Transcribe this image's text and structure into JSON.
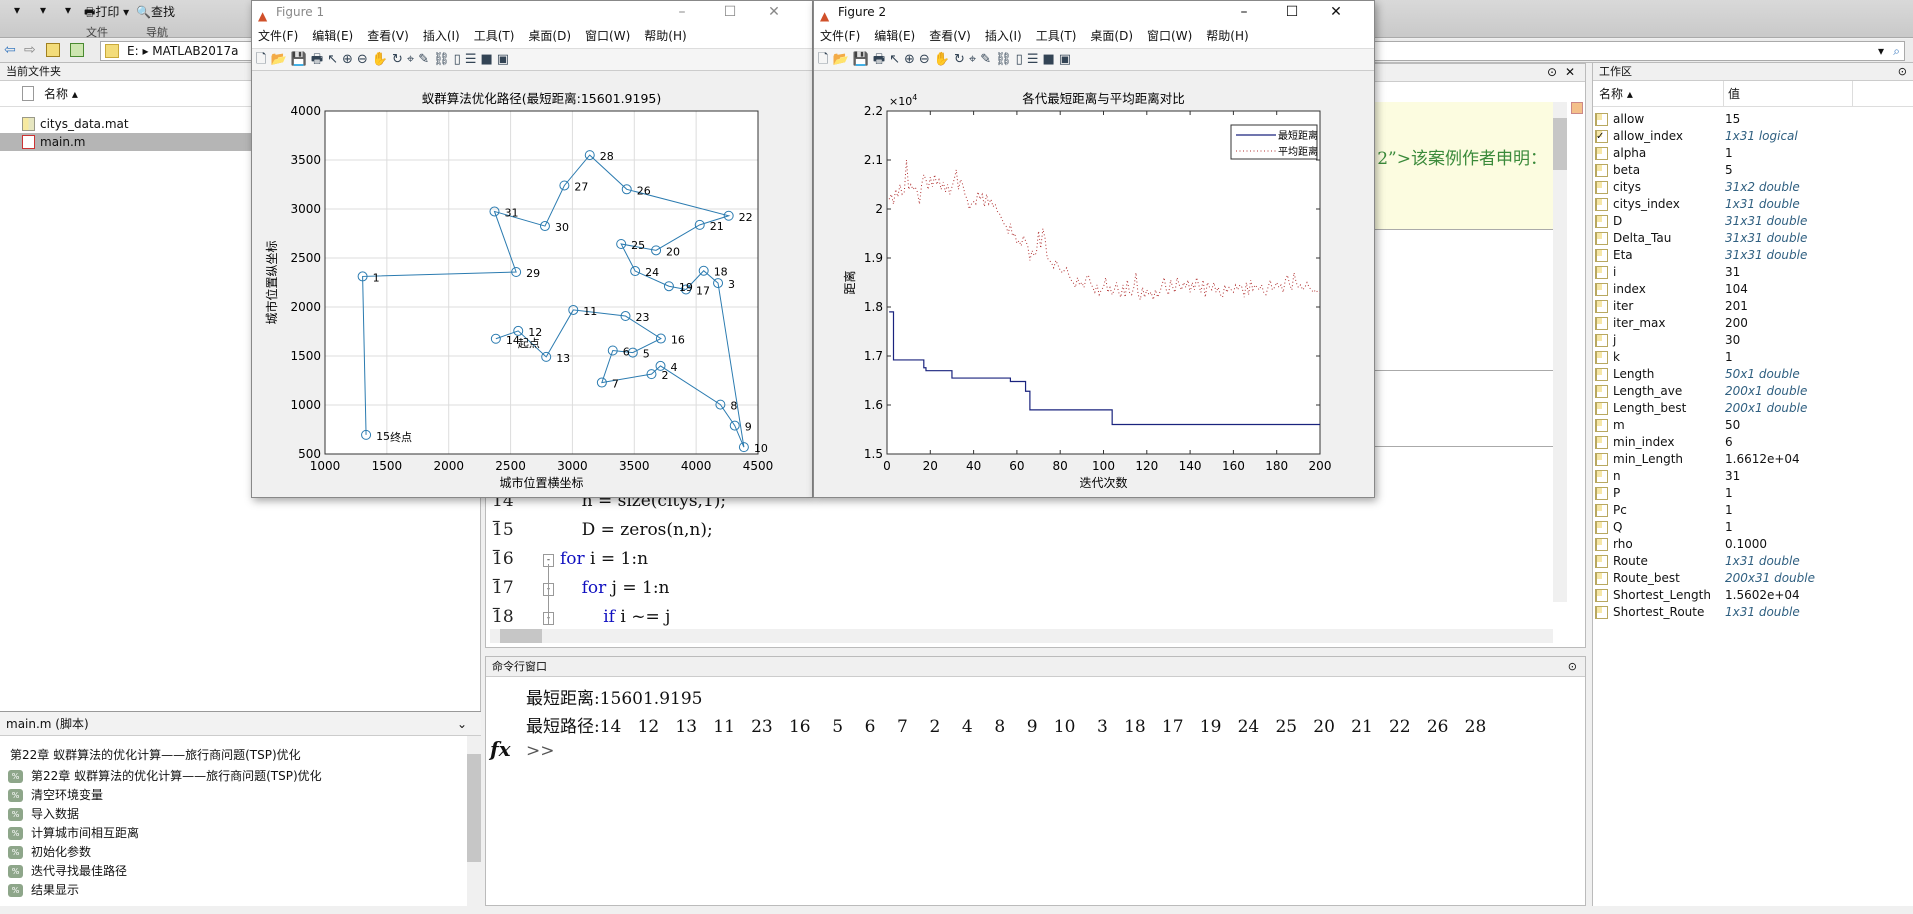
{
  "toolbar": {
    "print": "打印",
    "find": "查找",
    "group_file": "文件",
    "group_nav": "导航"
  },
  "address": {
    "path": "E:  ▸  MATLAB2017a"
  },
  "files": {
    "title": "当前文件夹",
    "col_name": "名称 ▴",
    "items": [
      {
        "name": "citys_data.mat",
        "selected": false
      },
      {
        "name": "main.m",
        "selected": true
      }
    ]
  },
  "details": {
    "title": "main.m  (脚本)",
    "heading": "第22章 蚁群算法的优化计算——旅行商问题(TSP)优化",
    "sections": [
      "第22章 蚁群算法的优化计算——旅行商问题(TSP)优化",
      "清空环境变量",
      "导入数据",
      "计算城市间相互距离",
      "初始化参数",
      "迭代寻找最佳路径",
      "结果显示"
    ]
  },
  "editor": {
    "cell_text": "2”>该案例作者申明：",
    "lines": [
      {
        "num": "14",
        "code": "    n = size(citys,1);"
      },
      {
        "num": "15",
        "code": "    D = zeros(n,n);"
      },
      {
        "num": "16",
        "kw": "for",
        "code": " i = 1:n"
      },
      {
        "num": "17",
        "kw": "    for",
        "code": " j = 1:n"
      },
      {
        "num": "18",
        "kw": "        if",
        "code": " i ~= j"
      }
    ]
  },
  "command": {
    "title": "命令行窗口",
    "line1": "最短距离:15601.9195",
    "line2": "最短路径:14   12   13   11   23   16    5    6    7    2    4    8    9   10    3   18   17   19   24   25   20   21   22   26   28",
    "prompt": ">>"
  },
  "workspace": {
    "title": "工作区",
    "col_name": "名称 ▴",
    "col_value": "值",
    "vars": [
      {
        "name": "allow",
        "value": "15"
      },
      {
        "name": "allow_index",
        "value": "1x31 logical",
        "type": "logical"
      },
      {
        "name": "alpha",
        "value": "1"
      },
      {
        "name": "beta",
        "value": "5"
      },
      {
        "name": "citys",
        "value": "31x2 double",
        "type": "array"
      },
      {
        "name": "citys_index",
        "value": "1x31 double",
        "type": "array"
      },
      {
        "name": "D",
        "value": "31x31 double",
        "type": "array"
      },
      {
        "name": "Delta_Tau",
        "value": "31x31 double",
        "type": "array"
      },
      {
        "name": "Eta",
        "value": "31x31 double",
        "type": "array"
      },
      {
        "name": "i",
        "value": "31"
      },
      {
        "name": "index",
        "value": "104"
      },
      {
        "name": "iter",
        "value": "201"
      },
      {
        "name": "iter_max",
        "value": "200"
      },
      {
        "name": "j",
        "value": "30"
      },
      {
        "name": "k",
        "value": "1"
      },
      {
        "name": "Length",
        "value": "50x1 double",
        "type": "array"
      },
      {
        "name": "Length_ave",
        "value": "200x1 double",
        "type": "array"
      },
      {
        "name": "Length_best",
        "value": "200x1 double",
        "type": "array"
      },
      {
        "name": "m",
        "value": "50"
      },
      {
        "name": "min_index",
        "value": "6"
      },
      {
        "name": "min_Length",
        "value": "1.6612e+04"
      },
      {
        "name": "n",
        "value": "31"
      },
      {
        "name": "P",
        "value": "1"
      },
      {
        "name": "Pc",
        "value": "1"
      },
      {
        "name": "Q",
        "value": "1"
      },
      {
        "name": "rho",
        "value": "0.1000"
      },
      {
        "name": "Route",
        "value": "1x31 double",
        "type": "array"
      },
      {
        "name": "Route_best",
        "value": "200x31 double",
        "type": "array"
      },
      {
        "name": "Shortest_Length",
        "value": "1.5602e+04"
      },
      {
        "name": "Shortest_Route",
        "value": "1x31 double",
        "type": "array"
      }
    ]
  },
  "figure_menu": [
    "文件(F)",
    "编辑(E)",
    "查看(V)",
    "插入(I)",
    "工具(T)",
    "桌面(D)",
    "窗口(W)",
    "帮助(H)"
  ],
  "figure1": {
    "title": "Figure 1",
    "active": false
  },
  "figure2": {
    "title": "Figure 2",
    "active": true
  },
  "chart_data": [
    {
      "type": "line",
      "title": "蚁群算法优化路径(最短距离:15601.9195)",
      "xlabel": "城市位置横坐标",
      "ylabel": "城市位置纵坐标",
      "xlim": [
        1000,
        4500
      ],
      "ylim": [
        500,
        4000
      ],
      "xticks": [
        1000,
        1500,
        2000,
        2500,
        3000,
        3500,
        4000,
        4500
      ],
      "yticks": [
        500,
        1000,
        1500,
        2000,
        2500,
        3000,
        3500,
        4000
      ],
      "grid": true,
      "color": "#2b7bb0",
      "marker": "circle",
      "cities": [
        [
          1304,
          2312
        ],
        [
          3639,
          1315
        ],
        [
          4177,
          2244
        ],
        [
          3712,
          1399
        ],
        [
          3488,
          1535
        ],
        [
          3326,
          1556
        ],
        [
          3238,
          1229
        ],
        [
          4196,
          1004
        ],
        [
          4312,
          790
        ],
        [
          4386,
          570
        ],
        [
          3007,
          1970
        ],
        [
          2562,
          1756
        ],
        [
          2788,
          1491
        ],
        [
          2381,
          1676
        ],
        [
          1332,
          695
        ],
        [
          3715,
          1678
        ],
        [
          3918,
          2179
        ],
        [
          4061,
          2370
        ],
        [
          3780,
          2212
        ],
        [
          3676,
          2578
        ],
        [
          4029,
          2838
        ],
        [
          4263,
          2931
        ],
        [
          3429,
          1908
        ],
        [
          3507,
          2367
        ],
        [
          3394,
          2643
        ],
        [
          3439,
          3201
        ],
        [
          2935,
          3240
        ],
        [
          3140,
          3550
        ],
        [
          2545,
          2357
        ],
        [
          2778,
          2826
        ],
        [
          2370,
          2975
        ]
      ],
      "route": [
        14,
        12,
        13,
        11,
        23,
        16,
        5,
        6,
        7,
        2,
        4,
        8,
        9,
        10,
        3,
        18,
        17,
        19,
        24,
        25,
        20,
        21,
        22,
        26,
        28,
        27,
        30,
        31,
        29,
        1,
        15
      ],
      "start_label": "起点",
      "end_label": "终点"
    },
    {
      "type": "line",
      "title": "各代最短距离与平均距离对比",
      "xlabel": "迭代次数",
      "ylabel": "距离",
      "xlim": [
        0,
        200
      ],
      "ylim": [
        15000,
        22000
      ],
      "xticks": [
        0,
        20,
        40,
        60,
        80,
        100,
        120,
        140,
        160,
        180,
        200
      ],
      "yticks": [
        "1.5",
        "1.6",
        "1.7",
        "1.8",
        "1.9",
        "2",
        "2.1",
        "2.2"
      ],
      "y_multiplier": "×10^4",
      "grid": false,
      "legend": "top-right",
      "series": [
        {
          "name": "最短距离",
          "style": "solid",
          "color": "#1a237e",
          "steps": [
            [
              1,
              17900
            ],
            [
              3,
              16920
            ],
            [
              17,
              16760
            ],
            [
              18,
              16700
            ],
            [
              30,
              16550
            ],
            [
              57,
              16480
            ],
            [
              64,
              16280
            ],
            [
              66,
              15900
            ],
            [
              104,
              15602
            ],
            [
              200,
              15602
            ]
          ]
        },
        {
          "name": "平均距离",
          "style": "dotted",
          "color": "#b03030",
          "values": [
            20200,
            20300,
            20100,
            20400,
            20250,
            20500,
            20300,
            20350,
            21000,
            20400,
            20500,
            20400,
            20450,
            20350,
            20100,
            20500,
            20700,
            20600,
            20400,
            20650,
            20450,
            20700,
            20500,
            20600,
            20400,
            20550,
            20350,
            20500,
            20300,
            20450,
            20600,
            20800,
            20400,
            20600,
            20500,
            20300,
            20200,
            20000,
            20100,
            20150,
            20100,
            20350,
            20200,
            20300,
            20050,
            20300,
            20100,
            20200,
            20050,
            20100,
            19950,
            19900,
            19800,
            19700,
            19650,
            19500,
            19700,
            19450,
            19500,
            19300,
            19350,
            19250,
            19450,
            19350,
            19250,
            18950,
            19150,
            19050,
            19100,
            19550,
            19200,
            19600,
            19400,
            19000,
            18950,
            18900,
            18800,
            18950,
            18850,
            18750,
            18700,
            18750,
            18800,
            18650,
            18550,
            18500,
            18400,
            18600,
            18450,
            18500,
            18400,
            18600,
            18650,
            18500,
            18400,
            18300,
            18450,
            18250,
            18350,
            18400,
            18600,
            18300,
            18400,
            18250,
            18350,
            18500,
            18300,
            18200,
            18450,
            18200,
            18550,
            18300,
            18250,
            18400,
            18700,
            18250,
            18150,
            18400,
            18200,
            18350,
            18250,
            18300,
            18150,
            18350,
            18200,
            18300,
            18450,
            18600,
            18350,
            18250,
            18550,
            18400,
            18300,
            18600,
            18450,
            18350,
            18500,
            18400,
            18550,
            18300,
            18500,
            18350,
            18600,
            18450,
            18300,
            18550,
            18200,
            18500,
            18400,
            18350,
            18500,
            18300,
            18400,
            18250,
            18200,
            18450,
            18300,
            18400,
            18350,
            18300,
            18450,
            18350,
            18450,
            18400,
            18200,
            18500,
            18250,
            18550,
            18350,
            18450,
            18400,
            18350,
            18450,
            18300,
            18250,
            18400,
            18550,
            18350,
            18400,
            18500,
            18400,
            18450,
            18300,
            18550,
            18650,
            18450,
            18350,
            18700,
            18500,
            18400,
            18450,
            18350,
            18400,
            18500,
            18400,
            18350,
            18300,
            18350,
            18300,
            18300
          ]
        }
      ]
    }
  ]
}
